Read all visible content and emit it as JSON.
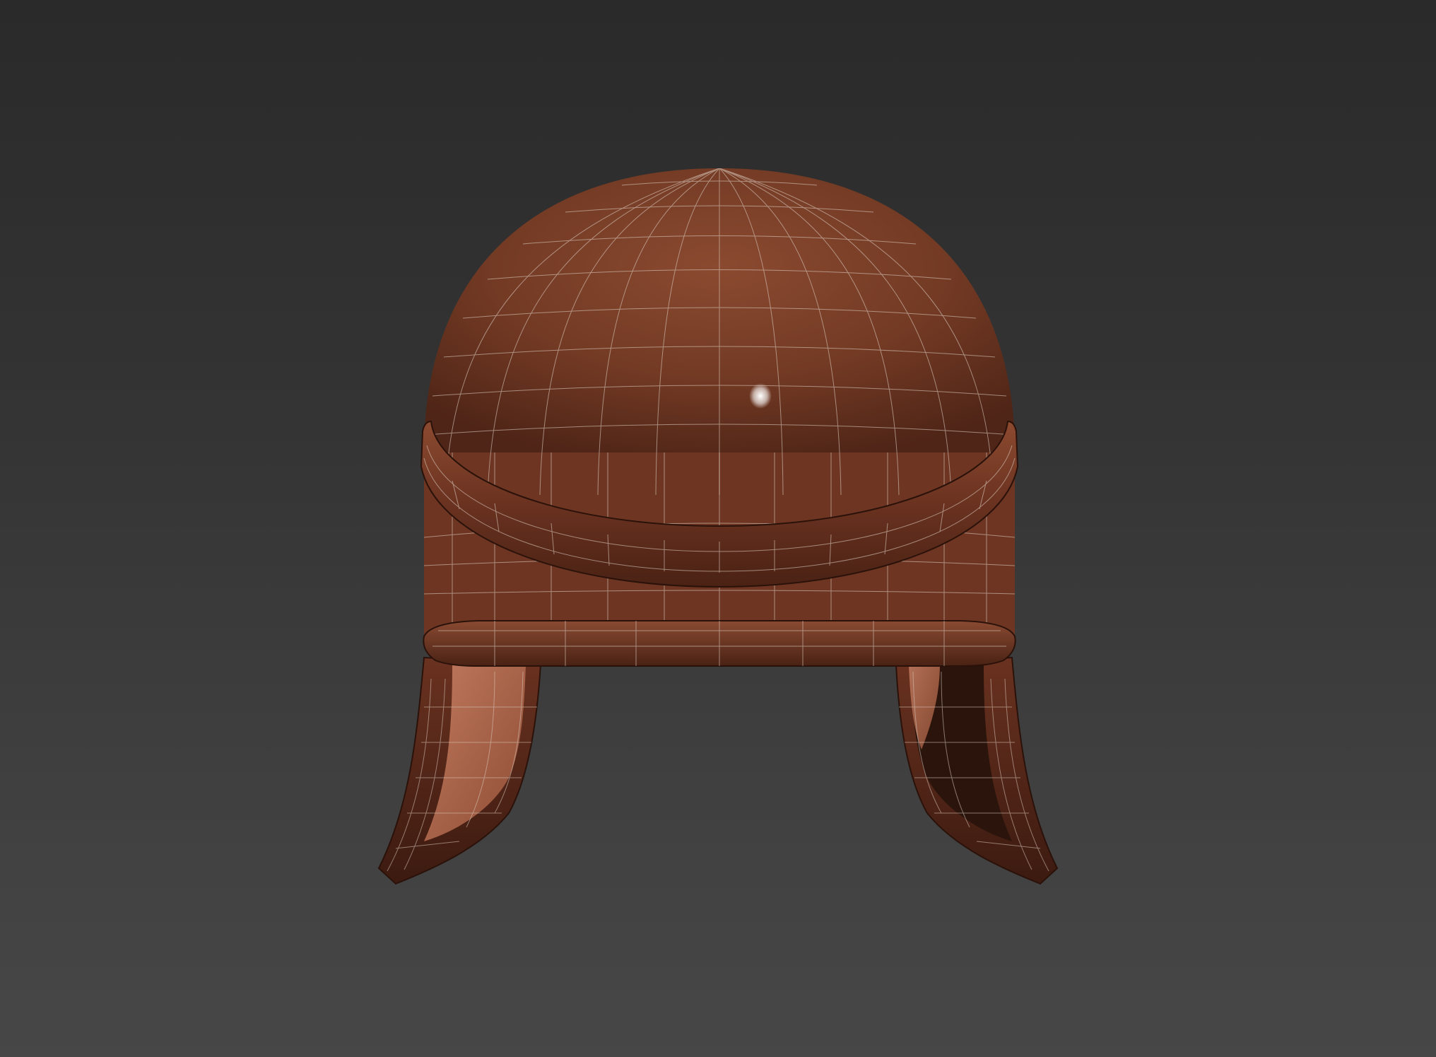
{
  "viewport": {
    "background_top": "#2a2a2a",
    "background_bottom": "#474747",
    "shading_mode": "textured-wireframe"
  },
  "model": {
    "object": "leather-helmet",
    "base_color": "#7a3e26",
    "shadow_color": "#4a2216",
    "highlight_color": "#9a5a3c",
    "inner_color": "#b07058",
    "wire_color": "#d8c8bc"
  }
}
